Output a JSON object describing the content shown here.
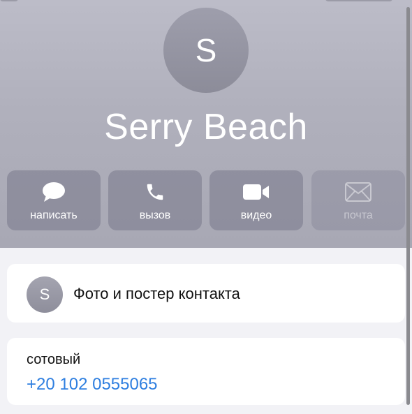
{
  "contact": {
    "avatar_initial": "S",
    "name": "Serry Beach"
  },
  "actions": [
    {
      "label": "написать",
      "icon": "message-bubble-icon",
      "enabled": true
    },
    {
      "label": "вызов",
      "icon": "phone-icon",
      "enabled": true
    },
    {
      "label": "видео",
      "icon": "video-camera-icon",
      "enabled": true
    },
    {
      "label": "почта",
      "icon": "mail-envelope-icon",
      "enabled": false
    }
  ],
  "photo_card": {
    "avatar_initial": "S",
    "title": "Фото и постер контакта"
  },
  "phone_card": {
    "type": "сотовый",
    "number": "+20 102 0555065"
  },
  "colors": {
    "link": "#2f7fe0",
    "header_bg": "#b0b0bc",
    "page_bg": "#f2f2f6"
  }
}
